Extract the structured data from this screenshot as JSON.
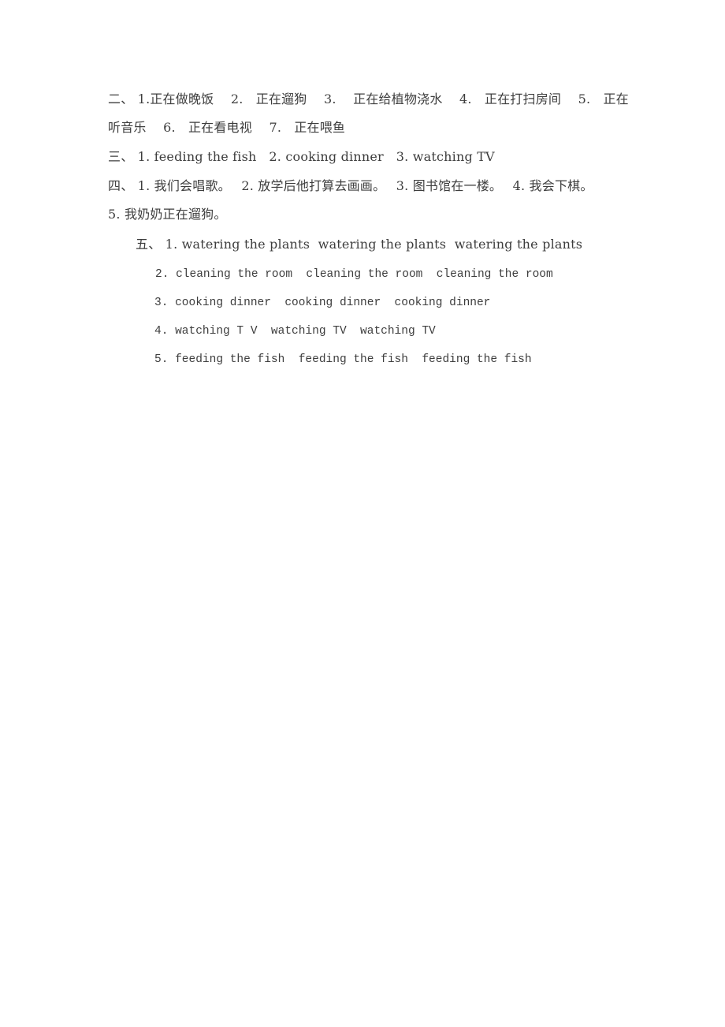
{
  "document": {
    "type": "answer-key-page",
    "background_color": "#ffffff",
    "text_color": "#3d3d3d",
    "sections": [
      {
        "marker": "二、",
        "id": "section-two",
        "lines": [
          "二、 1.正在做晚饭　 2.　正在遛狗　 3.　 正在给植物浇水　 4.　正在打扫房间　 5.　正在",
          "听音乐　 6.　正在看电视　 7.　正在喂鱼"
        ],
        "items": [
          "正在做晚饭",
          "正在遛狗",
          "正在给植物浇水",
          "正在打扫房间",
          "正在听音乐",
          "正在看电视",
          "正在喂鱼"
        ]
      },
      {
        "marker": "三、",
        "id": "section-three",
        "lines": [
          "三、 1. feeding the fish   2. cooking dinner   3. watching TV"
        ],
        "items": [
          "feeding the fish",
          "cooking dinner",
          "watching TV"
        ]
      },
      {
        "marker": "四、",
        "id": "section-four",
        "lines": [
          "四、 1. 我们会唱歌。　 2. 放学后他打算去画画。　 3. 图书馆在一楼。　 4. 我会下棋。",
          "5. 我奶奶正在遛狗。"
        ],
        "items": [
          "我们会唱歌。",
          "放学后他打算去画画。",
          "图书馆在一楼。",
          "我会下棋。",
          "我奶奶正在遛狗。"
        ]
      },
      {
        "marker": "五、",
        "id": "section-five",
        "lines": [
          "五、 1. watering the plants  watering the plants  watering the plants",
          " 2. cleaning the room  cleaning the room  cleaning the room",
          "3. cooking dinner  cooking dinner  cooking dinner",
          "4. watching T V  watching TV  watching TV",
          "5. feeding the fish  feeding the fish  feeding the fish"
        ],
        "items": [
          {
            "number": "1.",
            "phrase": "watering the plants",
            "repetitions": [
              "watering the plants",
              "watering the plants",
              "watering the plants"
            ]
          },
          {
            "number": "2.",
            "phrase": "cleaning the room",
            "repetitions": [
              "cleaning the room",
              "cleaning the room",
              "cleaning the room"
            ]
          },
          {
            "number": "3.",
            "phrase": "cooking dinner",
            "repetitions": [
              "cooking dinner",
              "cooking dinner",
              "cooking dinner"
            ]
          },
          {
            "number": "4.",
            "phrase": "watching TV",
            "repetitions": [
              "watching T V",
              "watching TV",
              "watching TV"
            ]
          },
          {
            "number": "5.",
            "phrase": "feeding the fish",
            "repetitions": [
              "feeding the fish",
              "feeding the fish",
              "feeding the fish"
            ]
          }
        ]
      }
    ]
  },
  "lines": {
    "l1": "二、 1.正在做晚饭　 2.　正在遛狗　 3.　 正在给植物浇水　 4.　正在打扫房间　 5.　正在",
    "l2": "听音乐　 6.　正在看电视　 7.　正在喂鱼",
    "l3": "三、 1. feeding the fish   2. cooking dinner   3. watching TV",
    "l4": "四、 1. 我们会唱歌。　 2. 放学后他打算去画画。　 3. 图书馆在一楼。　 4. 我会下棋。",
    "l5": "5. 我奶奶正在遛狗。",
    "l6": "五、 1. watering the plants  watering the plants  watering the plants",
    "l7": "2. cleaning the room  cleaning the room  cleaning the room",
    "l8": "3. cooking dinner  cooking dinner  cooking dinner",
    "l9": "4. watching T V  watching TV  watching TV",
    "l10": "5. feeding the fish  feeding the fish  feeding the fish"
  }
}
